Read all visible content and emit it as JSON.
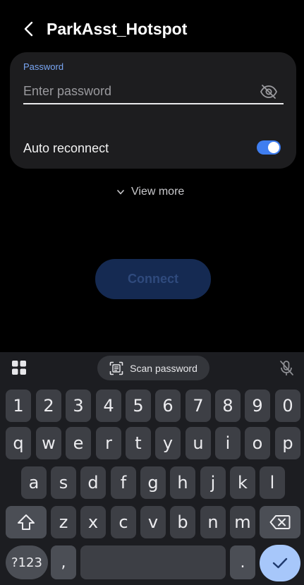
{
  "header": {
    "title": "ParkAsst_Hotspot",
    "back_icon": "chevron-left-icon"
  },
  "password": {
    "label": "Password",
    "placeholder": "Enter password",
    "value": "",
    "visibility_icon": "eye-off-icon"
  },
  "auto_reconnect": {
    "label": "Auto reconnect",
    "enabled": true
  },
  "view_more": {
    "label": "View more",
    "icon": "chevron-down-icon"
  },
  "connect": {
    "label": "Connect",
    "enabled": false
  },
  "keyboard": {
    "toolbar": {
      "apps_icon": "grid-icon",
      "scan_label": "Scan password",
      "scan_icon": "scan-text-icon",
      "mic_icon": "mic-off-icon"
    },
    "number_row": [
      "1",
      "2",
      "3",
      "4",
      "5",
      "6",
      "7",
      "8",
      "9",
      "0"
    ],
    "row1": [
      "q",
      "w",
      "e",
      "r",
      "t",
      "y",
      "u",
      "i",
      "o",
      "p"
    ],
    "row2": [
      "a",
      "s",
      "d",
      "f",
      "g",
      "h",
      "j",
      "k",
      "l"
    ],
    "row3": [
      "z",
      "x",
      "c",
      "v",
      "b",
      "n",
      "m"
    ],
    "symbols_label": "?123",
    "comma_label": ",",
    "period_label": ".",
    "shift_icon": "shift-icon",
    "backspace_icon": "backspace-icon",
    "enter_icon": "check-icon"
  },
  "colors": {
    "accent": "#3f7ef0",
    "label_blue": "#7aa7f5",
    "card_bg": "#1d1d1f",
    "keyboard_bg": "#1c1d21",
    "key_bg": "#3d3f45",
    "enter_key": "#a7c7fa",
    "connect_disabled": "#152a52"
  }
}
